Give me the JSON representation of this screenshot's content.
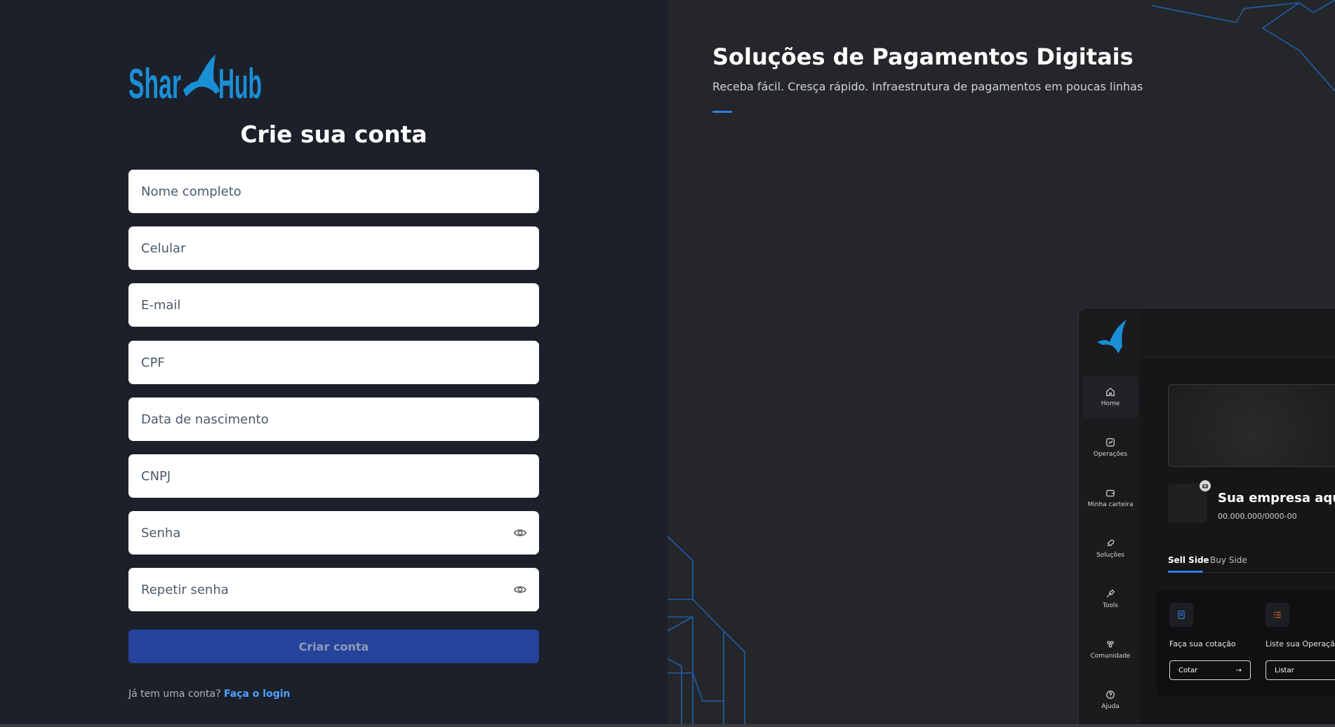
{
  "brand": {
    "name": "SharkHub",
    "name_left": "Shar",
    "name_right": "Hub",
    "color": "#1a8fd6"
  },
  "signup": {
    "title": "Crie sua conta",
    "fields": {
      "full_name": "Nome completo",
      "phone": "Celular",
      "email": "E-mail",
      "cpf": "CPF",
      "birth_date": "Data de nascimento",
      "cnpj": "CNPJ",
      "password": "Senha",
      "repeat_password": "Repetir senha"
    },
    "submit_label": "Criar conta",
    "login_prompt": "Já tem uma conta?",
    "login_link": "Faça o login"
  },
  "hero": {
    "title": "Soluções de Pagamentos Digitais",
    "subtitle": "Receba fácil. Cresça rápido. Infraestrutura de pagamentos em poucas linhas"
  },
  "mockup": {
    "nav": [
      "Home",
      "Operações",
      "Minha carteira",
      "Soluções",
      "Tools",
      "Comunidade",
      "Ajuda"
    ],
    "company_name": "Sua empresa aqui",
    "company_cnpj": "00.000.000/0000-00",
    "tabs": [
      "Sell Side",
      "Buy Side"
    ],
    "cards": [
      {
        "label": "Faça sua cotação",
        "button": "Cotar"
      },
      {
        "label": "Liste sua Operação",
        "button": "Listar"
      }
    ]
  },
  "colors": {
    "left_bg": "#1c202b",
    "right_bg": "#24262a",
    "accent": "#2f7fe0",
    "primary_button": "#25439b",
    "link": "#4da3ff"
  }
}
